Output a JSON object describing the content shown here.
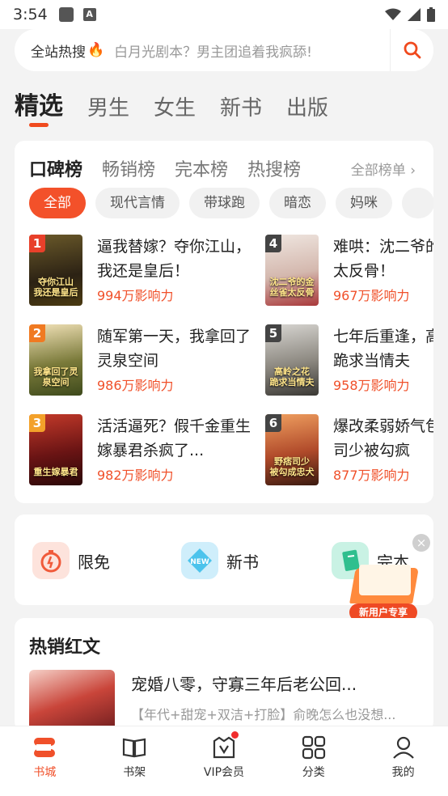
{
  "status_bar": {
    "time": "3:54",
    "notif_a": "A"
  },
  "search": {
    "hot_label": "全站热搜",
    "placeholder": "白月光剧本？男主团追着我疯舔!",
    "button": "search"
  },
  "top_tabs": [
    {
      "label": "精选",
      "active": true
    },
    {
      "label": "男生"
    },
    {
      "label": "女生"
    },
    {
      "label": "新书"
    },
    {
      "label": "出版"
    }
  ],
  "ranking": {
    "tabs": [
      "口碑榜",
      "畅销榜",
      "完本榜",
      "热搜榜"
    ],
    "all_label": "全部榜单 ›",
    "chips": [
      "全部",
      "现代言情",
      "带球跑",
      "暗恋",
      "妈咪",
      ""
    ],
    "books": [
      {
        "rank": "1",
        "title": "逼我替嫁？夺你江山，我还是皇后！",
        "influence": "994万影响力",
        "cover_text": "夺你江山 我还是皇后"
      },
      {
        "rank": "2",
        "title": "随军第一天，我拿回了灵泉空间",
        "influence": "986万影响力",
        "cover_text": "我拿回了灵泉空间"
      },
      {
        "rank": "3",
        "title": "活活逼死？假千金重生嫁暴君杀疯了...",
        "influence": "982万影响力",
        "cover_text": "重生嫁暴君"
      },
      {
        "rank": "4",
        "title": "难哄：沈二爷的金丝雀太反骨！",
        "influence": "967万影响力",
        "cover_text": "沈二爷的金丝雀太反骨"
      },
      {
        "rank": "5",
        "title": "七年后重逢，高岭之花跪求当情夫",
        "influence": "958万影响力",
        "cover_text": "高岭之花 跪求当情夫"
      },
      {
        "rank": "6",
        "title": "爆改柔弱娇气包，野痞司少被勾疯",
        "influence": "877万影响力",
        "cover_text": "野痞司少 被勾成忠犬"
      }
    ]
  },
  "features": [
    {
      "label": "限免",
      "icon": "stopwatch-icon"
    },
    {
      "label": "新书",
      "icon": "new-tag-icon"
    },
    {
      "label": "完本",
      "icon": "book-icon"
    }
  ],
  "promo": {
    "tag": "新用户专享",
    "close": "×"
  },
  "hot_section": {
    "title": "热销红文",
    "book_title": "宠婚八零，守寡三年后老公回...",
    "book_desc": "【年代+甜宠+双洁+打脸】俞晚怎么也没想..."
  },
  "bottom_nav": [
    {
      "label": "书城",
      "icon": "bookstore-icon",
      "active": true
    },
    {
      "label": "书架",
      "icon": "bookshelf-icon"
    },
    {
      "label": "VIP会员",
      "icon": "vip-icon"
    },
    {
      "label": "分类",
      "icon": "category-icon"
    },
    {
      "label": "我的",
      "icon": "profile-icon"
    }
  ],
  "colors": {
    "accent": "#f0502a",
    "rank1": "#e8402a",
    "rank2": "#f07a22",
    "rank3": "#f3a12a"
  }
}
